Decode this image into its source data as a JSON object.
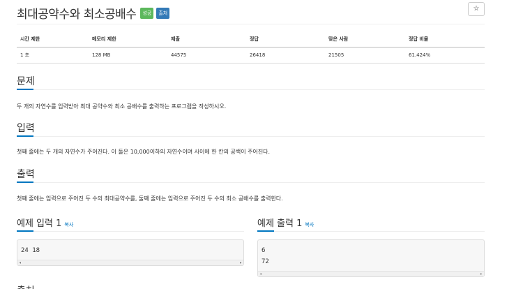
{
  "problem": {
    "title": "최대공약수와 최소공배수",
    "badges": [
      "성공",
      "출처"
    ],
    "star": "☆"
  },
  "info_table": {
    "headers": [
      "시간 제한",
      "메모리 제한",
      "제출",
      "정답",
      "맞은 사람",
      "정답 비율"
    ],
    "values": [
      "1 초",
      "128 MB",
      "44575",
      "26418",
      "21505",
      "61.424%"
    ]
  },
  "sections": {
    "problem": {
      "heading": "문제",
      "text": "두 개의 자연수를 입력받아 최대 공약수와 최소 공배수를 출력하는 프로그램을 작성하시오."
    },
    "input": {
      "heading": "입력",
      "text": "첫째 줄에는 두 개의 자연수가 주어진다. 이 둘은 10,000이하의 자연수이며 사이에 한 칸의 공백이 주어진다."
    },
    "output": {
      "heading": "출력",
      "text": "첫째 줄에는 입력으로 주어진 두 수의 최대공약수를, 둘째 줄에는 입력으로 주어진 두 수의 최소 공배수를 출력한다."
    },
    "next_heading": "출처"
  },
  "samples": {
    "input": {
      "heading": "예제 입력 1",
      "copy": "복사",
      "content": "24 18"
    },
    "output": {
      "heading": "예제 출력 1",
      "copy": "복사",
      "content": "6\n72"
    },
    "scroll_left": "◂",
    "scroll_right": "▸"
  },
  "colors": {
    "success": "#5cb85c",
    "print": "#337ab7",
    "accent": "#0076c0"
  }
}
